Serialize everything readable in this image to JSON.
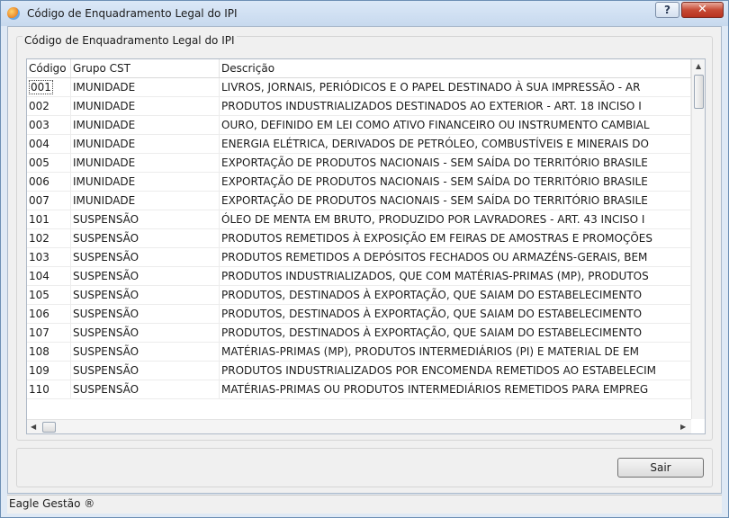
{
  "window": {
    "title": "Código de Enquadramento Legal do IPI",
    "help_label": "?",
    "close_label": "✕"
  },
  "group": {
    "title": "Código de Enquadramento Legal do IPI"
  },
  "table": {
    "columns": [
      "Código",
      "Grupo CST",
      "Descrição"
    ],
    "rows": [
      {
        "code": "001",
        "group": "IMUNIDADE",
        "desc": "LIVROS, JORNAIS, PERIÓDICOS E O PAPEL DESTINADO À SUA IMPRESSÃO - AR"
      },
      {
        "code": "002",
        "group": "IMUNIDADE",
        "desc": "PRODUTOS INDUSTRIALIZADOS DESTINADOS AO EXTERIOR - ART. 18 INCISO I"
      },
      {
        "code": "003",
        "group": "IMUNIDADE",
        "desc": "OURO, DEFINIDO EM LEI COMO ATIVO FINANCEIRO OU INSTRUMENTO CAMBIAL"
      },
      {
        "code": "004",
        "group": "IMUNIDADE",
        "desc": "ENERGIA ELÉTRICA, DERIVADOS DE PETRÓLEO, COMBUSTÍVEIS E MINERAIS DO"
      },
      {
        "code": "005",
        "group": "IMUNIDADE",
        "desc": "EXPORTAÇÃO DE PRODUTOS NACIONAIS - SEM SAÍDA DO TERRITÓRIO BRASILE"
      },
      {
        "code": "006",
        "group": "IMUNIDADE",
        "desc": "EXPORTAÇÃO DE PRODUTOS NACIONAIS - SEM SAÍDA DO TERRITÓRIO BRASILE"
      },
      {
        "code": "007",
        "group": "IMUNIDADE",
        "desc": "EXPORTAÇÃO DE PRODUTOS NACIONAIS - SEM SAÍDA DO TERRITÓRIO BRASILE"
      },
      {
        "code": "101",
        "group": "SUSPENSÃO",
        "desc": "ÓLEO DE MENTA EM BRUTO, PRODUZIDO POR LAVRADORES - ART. 43 INCISO I"
      },
      {
        "code": "102",
        "group": "SUSPENSÃO",
        "desc": "PRODUTOS REMETIDOS À EXPOSIÇÃO EM FEIRAS DE AMOSTRAS E PROMOÇÕES"
      },
      {
        "code": "103",
        "group": "SUSPENSÃO",
        "desc": "PRODUTOS REMETIDOS A DEPÓSITOS FECHADOS OU ARMAZÉNS-GERAIS, BEM"
      },
      {
        "code": "104",
        "group": "SUSPENSÃO",
        "desc": "PRODUTOS INDUSTRIALIZADOS, QUE COM MATÉRIAS-PRIMAS (MP), PRODUTOS"
      },
      {
        "code": "105",
        "group": "SUSPENSÃO",
        "desc": "PRODUTOS, DESTINADOS À EXPORTAÇÃO, QUE SAIAM DO ESTABELECIMENTO"
      },
      {
        "code": "106",
        "group": "SUSPENSÃO",
        "desc": "PRODUTOS, DESTINADOS À EXPORTAÇÃO, QUE SAIAM DO ESTABELECIMENTO"
      },
      {
        "code": "107",
        "group": "SUSPENSÃO",
        "desc": "PRODUTOS, DESTINADOS À EXPORTAÇÃO, QUE SAIAM DO ESTABELECIMENTO"
      },
      {
        "code": "108",
        "group": "SUSPENSÃO",
        "desc": "MATÉRIAS-PRIMAS (MP), PRODUTOS INTERMEDIÁRIOS (PI) E MATERIAL DE EM"
      },
      {
        "code": "109",
        "group": "SUSPENSÃO",
        "desc": "PRODUTOS INDUSTRIALIZADOS POR ENCOMENDA REMETIDOS AO ESTABELECIM"
      },
      {
        "code": "110",
        "group": "SUSPENSÃO",
        "desc": "MATÉRIAS-PRIMAS OU PRODUTOS INTERMEDIÁRIOS REMETIDOS PARA EMPREG"
      }
    ]
  },
  "buttons": {
    "exit_label": "Sair"
  },
  "statusbar": {
    "text": "Eagle Gestão ®"
  }
}
